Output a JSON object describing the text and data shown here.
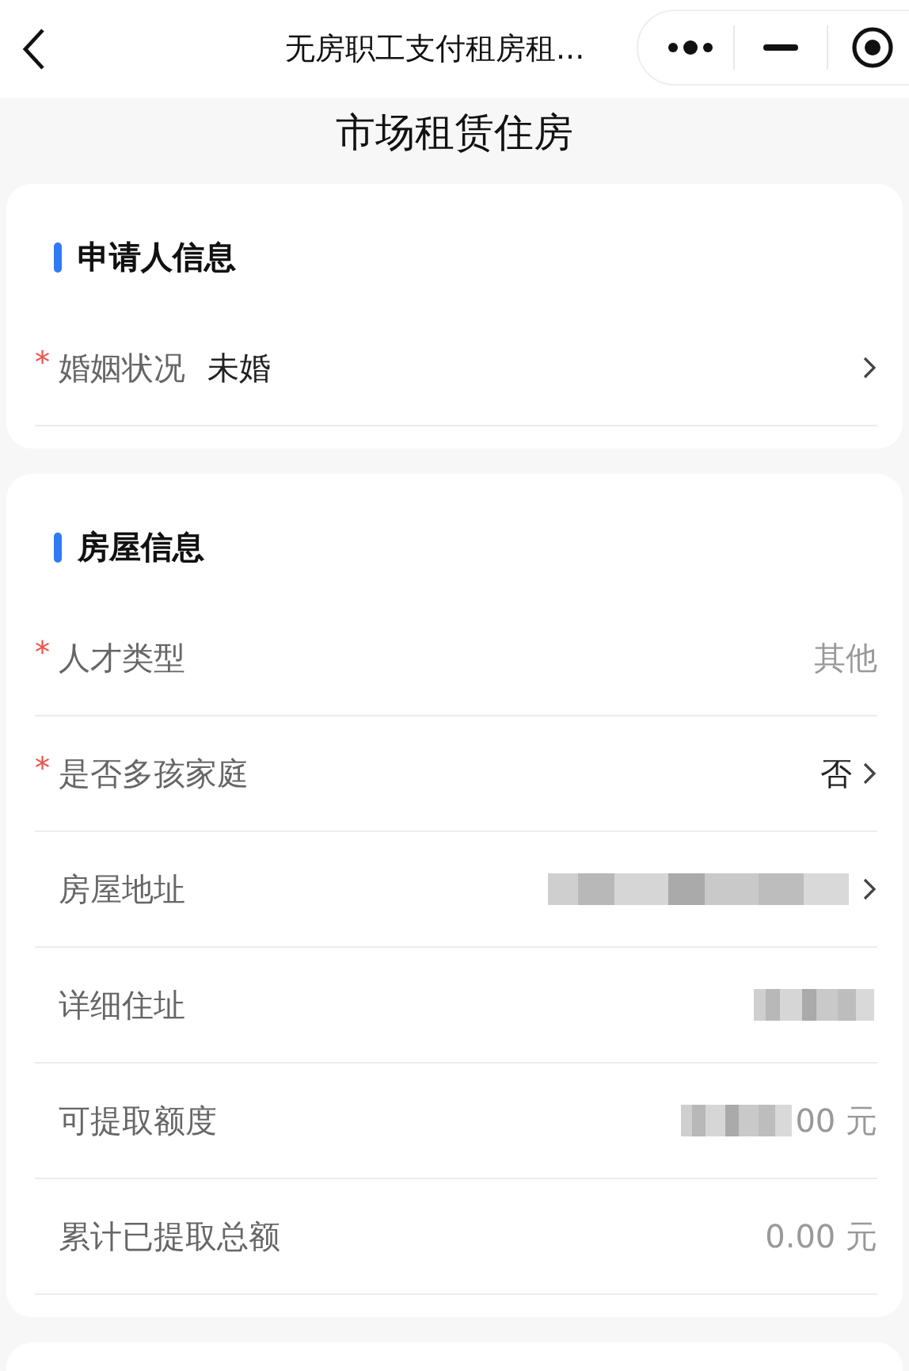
{
  "nav_bar": {
    "title": "无房职工支付租房租..."
  },
  "page_title": "市场租赁住房",
  "required_mark": "*",
  "sections": [
    {
      "title": "申请人信息",
      "rows": [
        {
          "kind": "inline",
          "label": "婚姻状况",
          "required": true,
          "value": "未婚",
          "muted": false,
          "arrow": true,
          "redacted": false
        }
      ]
    },
    {
      "title": "房屋信息",
      "rows": [
        {
          "kind": "right",
          "label": "人才类型",
          "required": true,
          "value": "其他",
          "muted": true,
          "arrow": false,
          "redacted": false
        },
        {
          "kind": "right",
          "label": "是否多孩家庭",
          "required": true,
          "value": "否",
          "muted": false,
          "arrow": true,
          "redacted": false
        },
        {
          "kind": "right",
          "label": "房屋地址",
          "required": false,
          "arrow": true,
          "redacted": true
        },
        {
          "kind": "right",
          "label": "详细住址",
          "required": false,
          "arrow": false,
          "redacted": true
        },
        {
          "kind": "right",
          "label": "可提取额度",
          "required": false,
          "value": "00 元",
          "muted": true,
          "arrow": false,
          "redacted": true
        },
        {
          "kind": "right",
          "label": "累计已提取总额",
          "required": false,
          "value": "0.00 元",
          "muted": true,
          "arrow": false,
          "redacted": false
        }
      ]
    }
  ]
}
